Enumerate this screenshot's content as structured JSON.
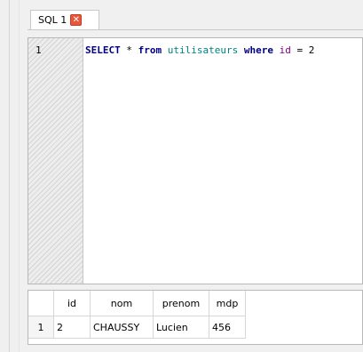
{
  "tabs": [
    {
      "label": "SQL 1",
      "active": true,
      "close_glyph": "✕"
    }
  ],
  "editor": {
    "line_numbers": [
      "1"
    ],
    "code_tokens": [
      {
        "text": "SELECT",
        "kind": "keyword"
      },
      {
        "text": " * ",
        "kind": "operator"
      },
      {
        "text": "from",
        "kind": "keyword"
      },
      {
        "text": " ",
        "kind": "space"
      },
      {
        "text": "utilisateurs",
        "kind": "identifier"
      },
      {
        "text": " ",
        "kind": "space"
      },
      {
        "text": "where",
        "kind": "keyword"
      },
      {
        "text": " ",
        "kind": "space"
      },
      {
        "text": "id",
        "kind": "column"
      },
      {
        "text": " = ",
        "kind": "operator"
      },
      {
        "text": "2",
        "kind": "number"
      }
    ]
  },
  "results": {
    "columns": [
      "id",
      "nom",
      "prenom",
      "mdp"
    ],
    "rows": [
      {
        "row_number": "1",
        "cells": [
          "2",
          "CHAUSSY",
          "Lucien",
          "456"
        ]
      }
    ]
  },
  "colors": {
    "keyword": "#000080",
    "identifier": "#008080",
    "column": "#800080",
    "close_button": "#e8573a"
  }
}
